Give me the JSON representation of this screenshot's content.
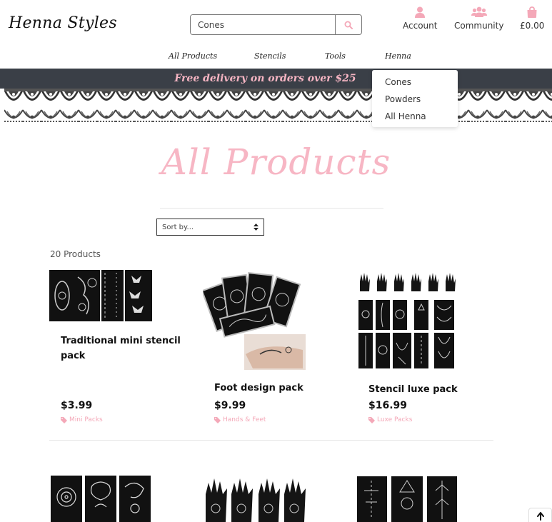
{
  "header": {
    "logo": "Henna Styles",
    "search": {
      "value": "Cones",
      "placeholder": "Search"
    },
    "account_label": "Account",
    "community_label": "Community",
    "bag_total": "£0.00"
  },
  "nav": {
    "items": [
      {
        "label": "All Products"
      },
      {
        "label": "Stencils"
      },
      {
        "label": "Tools"
      },
      {
        "label": "Henna"
      }
    ],
    "dropdown": [
      "Cones",
      "Powders",
      "All Henna"
    ]
  },
  "banner": {
    "text": "Free delivery on orders over $25"
  },
  "page": {
    "title": "All Products",
    "sort_label": "Sort by...",
    "product_count": "20 Products"
  },
  "products": [
    {
      "name": "Traditional mini stencil pack",
      "price": "$3.99",
      "category": "Mini Packs"
    },
    {
      "name": "Foot design pack",
      "price": "$9.99",
      "category": "Hands & Feet"
    },
    {
      "name": "Stencil luxe pack",
      "price": "$16.99",
      "category": "Luxe Packs"
    }
  ],
  "colors": {
    "accent": "#f7b6c4",
    "banner_bg": "#3a3f47",
    "category": "#f4a8b8"
  },
  "icons": [
    "search-icon",
    "user-icon",
    "users-icon",
    "shopping-bag-icon",
    "tag-icon",
    "arrow-up-icon"
  ]
}
